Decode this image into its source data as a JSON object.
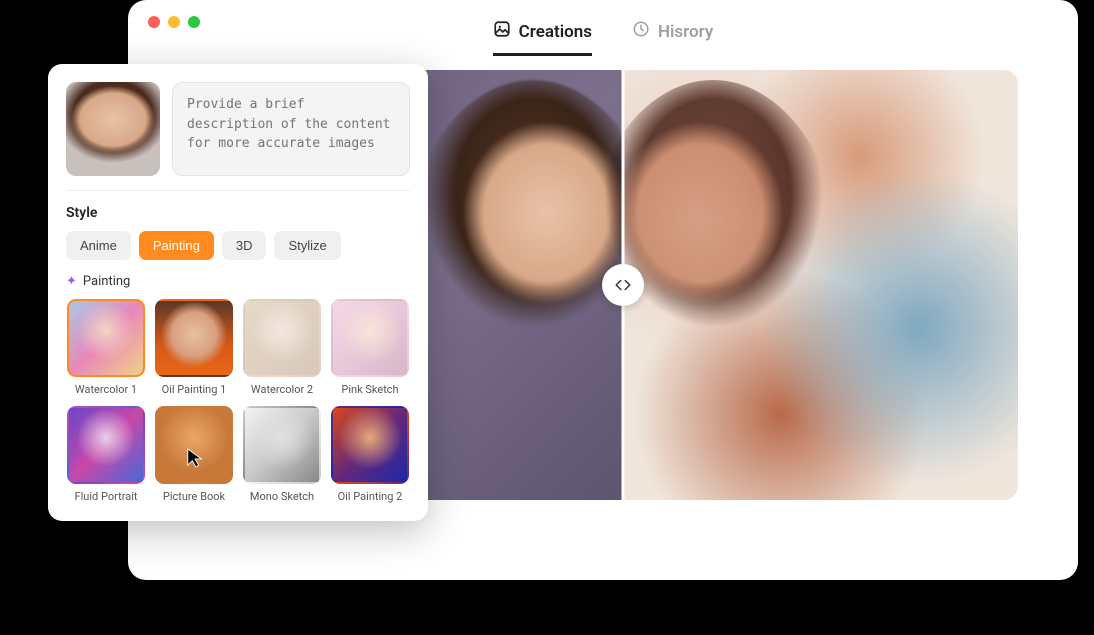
{
  "tabs": {
    "creations": "Creations",
    "history": "Hisrory"
  },
  "prompt": {
    "placeholder": "Provide a brief description of the content for more accurate images"
  },
  "style": {
    "section_label": "Style",
    "options": {
      "anime": "Anime",
      "painting": "Painting",
      "threeD": "3D",
      "stylize": "Stylize"
    },
    "active_header": "Painting",
    "presets": [
      {
        "name": "Watercolor 1"
      },
      {
        "name": "Oil Painting 1"
      },
      {
        "name": "Watercolor 2"
      },
      {
        "name": "Pink Sketch"
      },
      {
        "name": "Fluid Portrait"
      },
      {
        "name": "Picture Book"
      },
      {
        "name": "Mono Sketch"
      },
      {
        "name": "Oil Painting 2"
      }
    ]
  }
}
